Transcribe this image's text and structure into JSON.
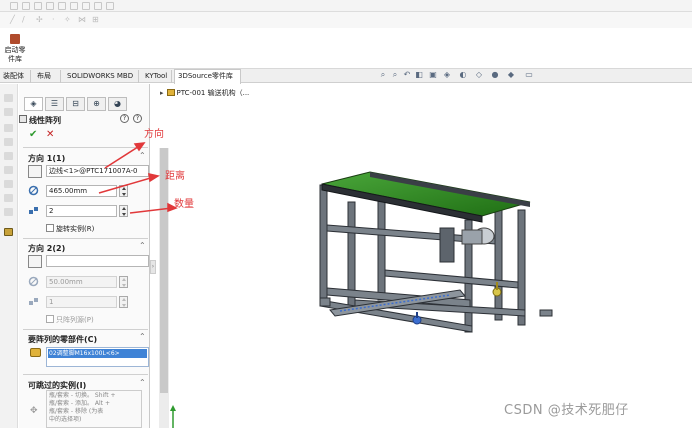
{
  "ribbon": {
    "launch_label_line1": "启动零",
    "launch_label_line2": "件库"
  },
  "tabs": [
    {
      "label": "装配体"
    },
    {
      "label": "布局"
    },
    {
      "label": "SOLIDWORKS MBD"
    },
    {
      "label": "KYTool"
    },
    {
      "label": "3DSource零件库",
      "active": true
    }
  ],
  "property_manager": {
    "title": "线性阵列",
    "help_symbol": "?",
    "close_symbol": "✕",
    "ok_symbol": "✔",
    "cancel_symbol": "✕",
    "direction1": {
      "header": "方向 1(1)",
      "edge": "边线<1>@PTC171007A-0",
      "spacing": "465.00mm",
      "count": "2",
      "rotate_label": "旋转实例(R)"
    },
    "direction2": {
      "header": "方向 2(2)",
      "edge": "",
      "spacing": "50.00mm",
      "count": "1",
      "seed_only_label": "只阵列源(P)"
    },
    "components": {
      "header": "要阵列的零部件(C)",
      "selected": "02调整脚M16x100L<6>"
    },
    "skip": {
      "header": "可跳过的实例(I)",
      "help_text": "瓶/套索 - 切换。 Shift +\n瓶/套索 - 添加。 Alt +\n瓶/套索 - 移除 (为表\n中的选择项)"
    }
  },
  "tree": {
    "arrow": "▸",
    "label": "PTC-001 输送机构（..."
  },
  "annotations": {
    "direction": "方向",
    "distance": "距离",
    "quantity": "数量"
  },
  "watermark": "CSDN @技术死肥仔",
  "colors": {
    "annotation": "#e1383a",
    "selection": "#3f83d6",
    "ok": "#2f9a2f",
    "cancel": "#c42222",
    "belt": "#2e8a1f",
    "frame": "#3a3f46"
  }
}
